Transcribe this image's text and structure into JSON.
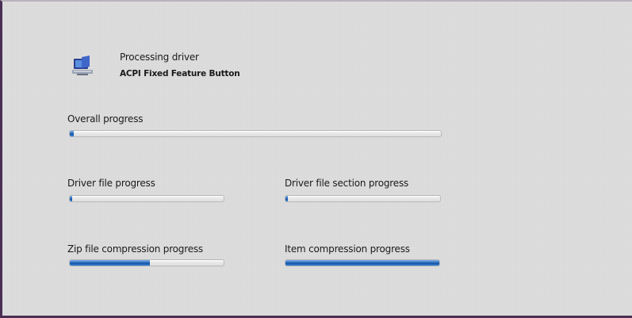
{
  "dialog": {
    "status_line": "Processing driver",
    "current_item": "ACPI Fixed Feature Button",
    "icon": "computer-install-icon"
  },
  "progress": {
    "overall": {
      "label": "Overall progress",
      "value": 0.01
    },
    "driver_file": {
      "label": "Driver file progress",
      "value": 0.01
    },
    "driver_file_section": {
      "label": "Driver file section progress",
      "value": 0.01
    },
    "zip_compression": {
      "label": "Zip file compression progress",
      "value": 0.52
    },
    "item_compression": {
      "label": "Item compression progress",
      "value": 1.0
    }
  },
  "colors": {
    "fill_accent": "#2b6fc4",
    "window_bg": "#d9d9d9",
    "frame": "#4a2f54"
  }
}
